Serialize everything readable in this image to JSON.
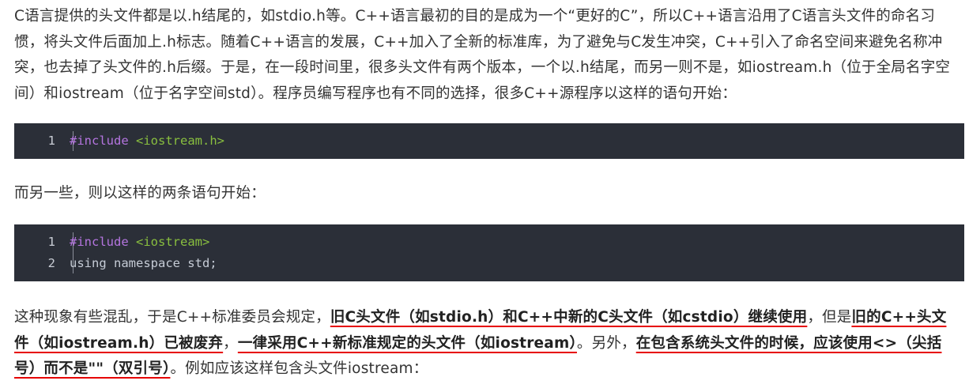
{
  "paragraphs": {
    "intro": "C语言提供的头文件都是以.h结尾的，如stdio.h等。C++语言最初的目的是成为一个“更好的C”，所以C++语言沿用了C语言头文件的命名习惯，将头文件后面加上.h标志。随着C++语言的发展，C++加入了全新的标准库，为了避免与C发生冲突，C++引入了命名空间来避免名称冲突，也去掉了头文件的.h后缀。于是，在一段时间里，很多头文件有两个版本，一个以.h结尾，而另一则不是，如iostream.h（位于全局名字空间）和iostream（位于名字空间std）。程序员编写程序也有不同的选择，很多C++源程序以这样的语句开始：",
    "middle": "而另一些，则以这样的两条语句开始：",
    "final": {
      "t1": "这种现象有些混乱，于是C++标准委员会规定，",
      "h1": "旧C头文件（如stdio.h）和C++中新的C头文件（如cstdio）继续使用",
      "t2": "，但是",
      "h2": "旧的C++头文件（如iostream.h）已被废弃",
      "t3": "，",
      "h3": "一律采用C++新标准规定的头文件（如iostream）",
      "t4": "。另外，",
      "h4": "在包含系统头文件的时候，应该使用<>（尖括号）而不是\"\"（双引号）",
      "t5": "。例如应该这样包含头文件iostream："
    }
  },
  "code_blocks": [
    {
      "lines": [
        {
          "number": "1",
          "keyword": "#include",
          "space": " ",
          "header": "<iostream.h>"
        }
      ]
    },
    {
      "lines": [
        {
          "number": "1",
          "keyword": "#include",
          "space": " ",
          "header": "<iostream>"
        },
        {
          "number": "2",
          "text": "using namespace std;"
        }
      ]
    }
  ],
  "colors": {
    "code_background": "#2b2f38",
    "keyword": "#b575e0",
    "string": "#89bf3f",
    "annotation_underline": "#e60000"
  }
}
